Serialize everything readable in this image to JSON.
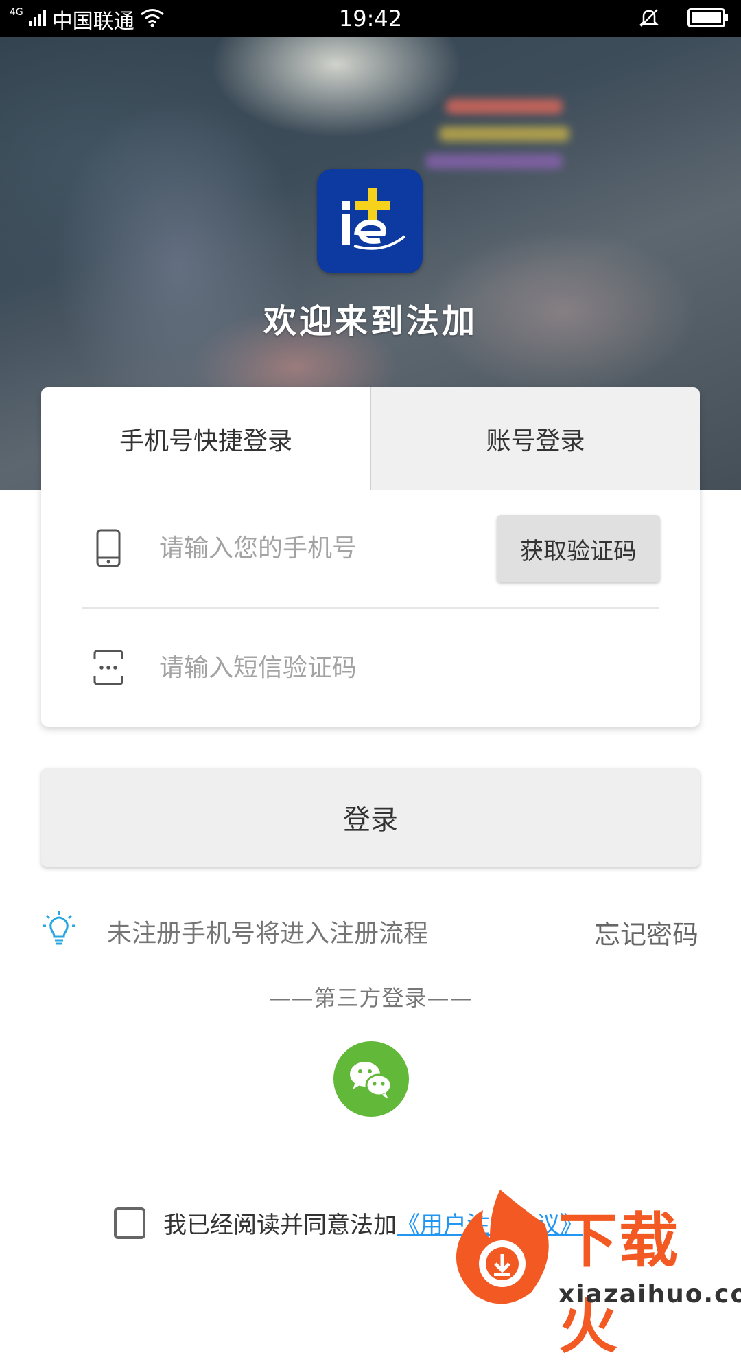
{
  "status_bar": {
    "network": "4G",
    "carrier": "中国联通",
    "time": "19:42"
  },
  "hero": {
    "welcome": "欢迎来到法加",
    "logo_icon": "fajia-logo",
    "logo_color": "#0d3aa0"
  },
  "tabs": [
    {
      "label": "手机号快捷登录",
      "active": true
    },
    {
      "label": "账号登录",
      "active": false
    }
  ],
  "phone_field": {
    "placeholder": "请输入您的手机号",
    "value": "",
    "icon": "phone-icon"
  },
  "code_field": {
    "placeholder": "请输入短信验证码",
    "value": "",
    "icon": "sms-code-icon"
  },
  "get_code_button": "获取验证码",
  "login_button": "登录",
  "hint": {
    "icon": "lightbulb-icon",
    "text": "未注册手机号将进入注册流程"
  },
  "forgot_password": "忘记密码",
  "third_party": {
    "title": "——第三方登录——",
    "options": [
      "wechat-icon"
    ]
  },
  "agreement": {
    "checked": false,
    "text": "我已经阅读并同意法加",
    "link": "《用户注册协议》"
  },
  "watermark": {
    "brand": "下载火",
    "domain": "xiazaihuo.com"
  },
  "colors": {
    "link": "#2196f3",
    "wechat": "#62b839",
    "hint_icon": "#29a8e0",
    "watermark": "#f35a23"
  }
}
